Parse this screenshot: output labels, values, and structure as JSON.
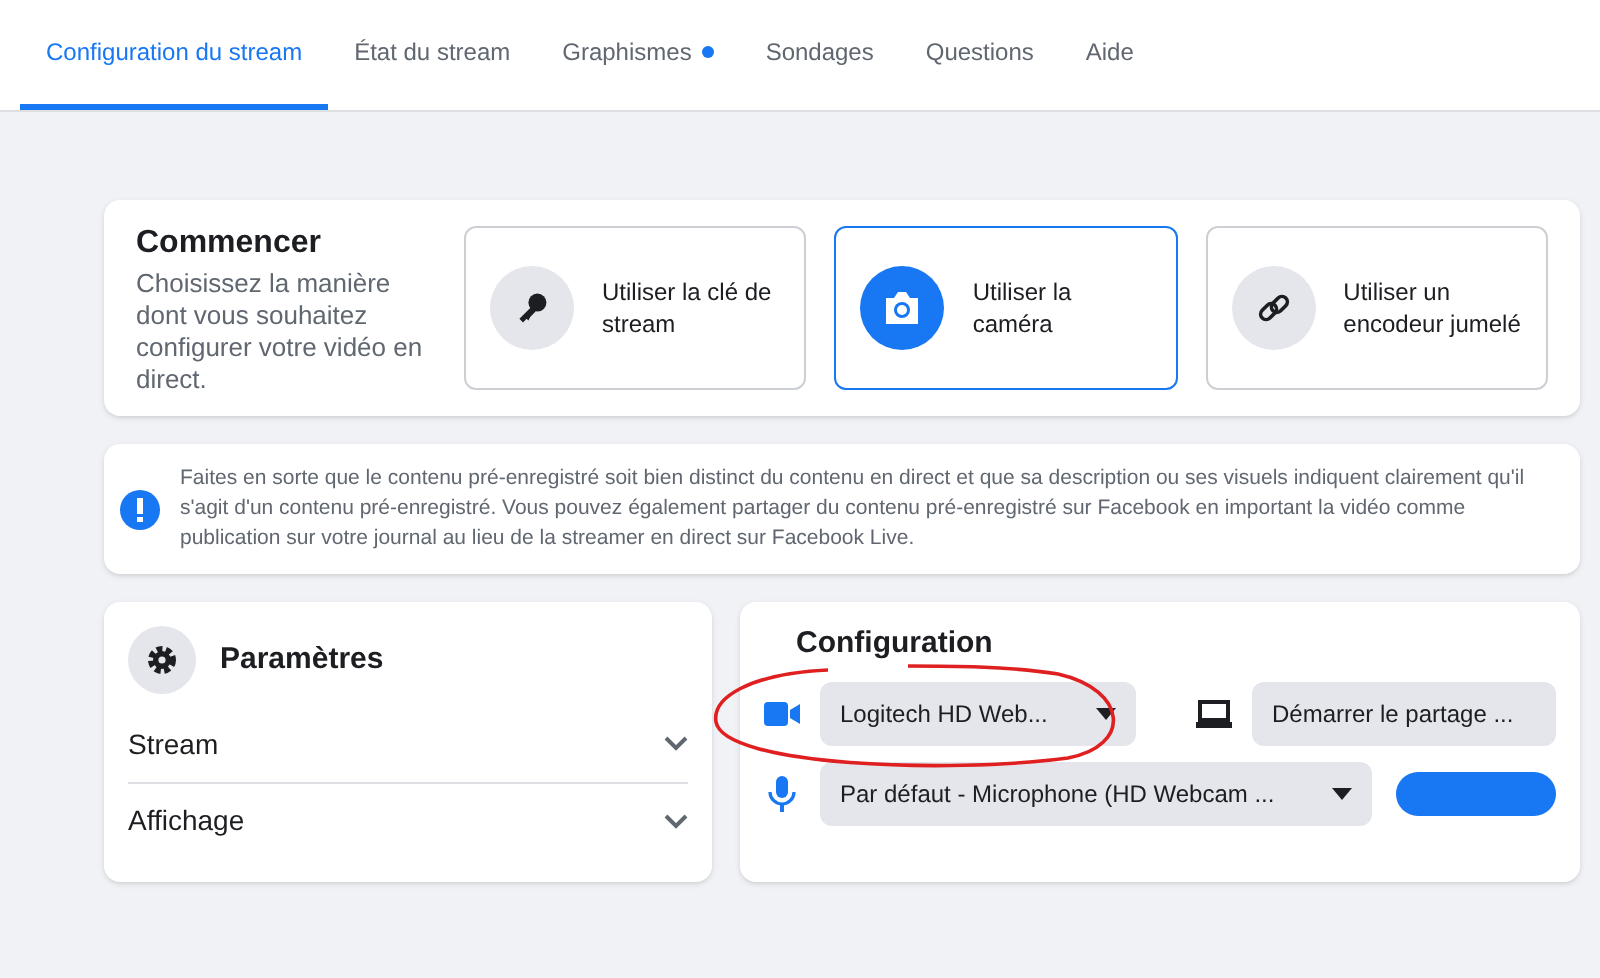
{
  "tabs": [
    {
      "label": "Configuration du stream",
      "selected": true,
      "dot": false
    },
    {
      "label": "État du stream",
      "selected": false,
      "dot": false
    },
    {
      "label": "Graphismes",
      "selected": false,
      "dot": true
    },
    {
      "label": "Sondages",
      "selected": false,
      "dot": false
    },
    {
      "label": "Questions",
      "selected": false,
      "dot": false
    },
    {
      "label": "Aide",
      "selected": false,
      "dot": false
    }
  ],
  "start": {
    "title": "Commencer",
    "description": "Choisissez la manière dont vous souhaitez configurer votre vidéo en direct.",
    "options": [
      {
        "kind": "key",
        "label": "Utiliser la clé de stream",
        "selected": false
      },
      {
        "kind": "camera",
        "label": "Utiliser la caméra",
        "selected": true
      },
      {
        "kind": "link",
        "label": "Utiliser un encodeur jumelé",
        "selected": false
      }
    ]
  },
  "notice": "Faites en sorte que le contenu pré-enregistré soit bien distinct du contenu en direct et que sa description ou ses visuels indiquent clairement qu'il s'agit d'un contenu pré-enregistré. Vous pouvez également partager du contenu pré-enregistré sur Facebook en important la vidéo comme publication sur votre journal au lieu de la streamer en direct sur Facebook Live.",
  "settings": {
    "title": "Paramètres",
    "sections": [
      {
        "label": "Stream",
        "expanded": false
      },
      {
        "label": "Affichage",
        "expanded": false
      }
    ]
  },
  "configuration": {
    "title": "Configuration",
    "camera": "Logitech HD Web...",
    "screen_share": "Démarrer le partage ...",
    "microphone": "Par défaut - Microphone (HD Webcam ..."
  }
}
